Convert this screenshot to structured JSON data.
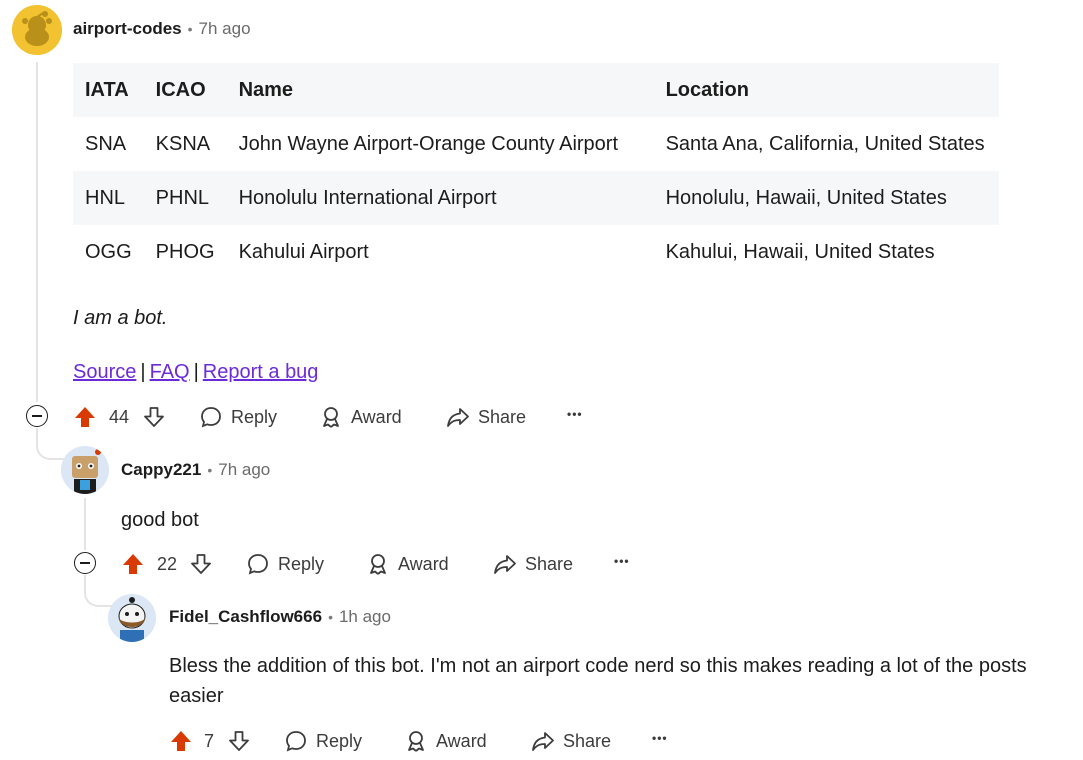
{
  "bot_comment": {
    "author": "airport-codes",
    "time": "7h ago",
    "table": {
      "headers": [
        "IATA",
        "ICAO",
        "Name",
        "Location"
      ],
      "rows": [
        [
          "SNA",
          "KSNA",
          "John Wayne Airport-Orange County Airport",
          "Santa Ana, California, United States"
        ],
        [
          "HNL",
          "PHNL",
          "Honolulu International Airport",
          "Honolulu, Hawaii, United States"
        ],
        [
          "OGG",
          "PHOG",
          "Kahului Airport",
          "Kahului, Hawaii, United States"
        ]
      ]
    },
    "note": "I am a bot.",
    "links": {
      "source": "Source",
      "faq": "FAQ",
      "report": "Report a bug",
      "pipe": "|"
    },
    "votes": "44"
  },
  "reply1": {
    "author": "Cappy221",
    "time": "7h ago",
    "body": "good bot",
    "votes": "22"
  },
  "reply2": {
    "author": "Fidel_Cashflow666",
    "time": "1h ago",
    "body": "Bless the addition of this bot. I'm not an airport code nerd so this makes reading a lot of the posts easier",
    "votes": "7"
  },
  "actions": {
    "reply": "Reply",
    "award": "Award",
    "share": "Share",
    "more": "•••"
  },
  "meta_sep": "•",
  "colors": {
    "upvote": "#d93a00",
    "link": "#6c2bd9",
    "snoo_bg": "#f2c230"
  }
}
